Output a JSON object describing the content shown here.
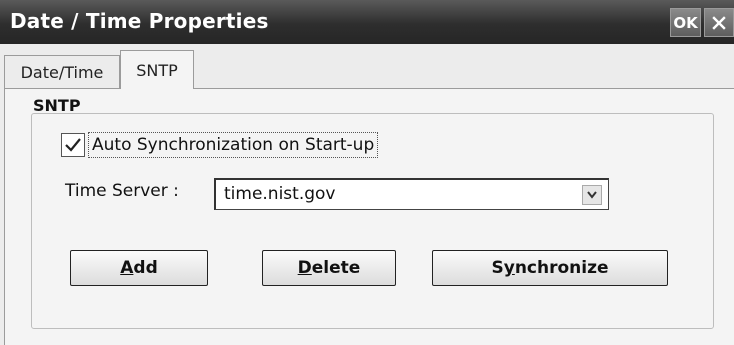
{
  "window": {
    "title": "Date / Time Properties",
    "ok_label": "OK",
    "close_icon": "close-icon"
  },
  "tabs": [
    {
      "label": "Date/Time",
      "selected": false
    },
    {
      "label": "SNTP",
      "selected": true
    }
  ],
  "sntp": {
    "group_label": "SNTP",
    "auto_sync": {
      "label": "Auto Synchronization on Start-up",
      "checked": true
    },
    "time_server": {
      "label": "Time Server :",
      "value": "time.nist.gov"
    },
    "buttons": {
      "add": {
        "mnemonic": "A",
        "rest": "dd"
      },
      "delete": {
        "mnemonic": "D",
        "rest": "elete"
      },
      "synchronize": {
        "pre": "S",
        "mnemonic": "y",
        "rest": "nchronize"
      }
    }
  }
}
